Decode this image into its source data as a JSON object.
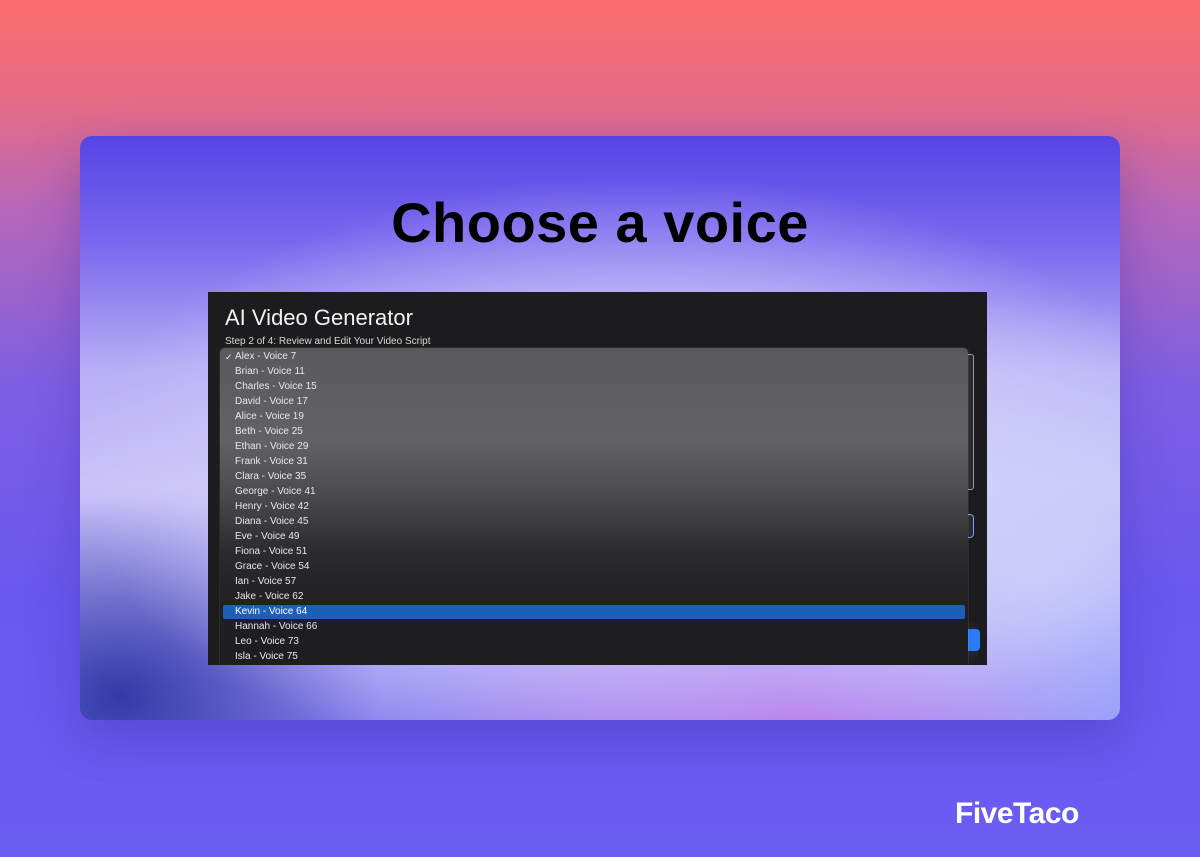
{
  "slide": {
    "heading": "Choose a voice",
    "brand": "FiveTaco"
  },
  "app": {
    "title": "AI Video Generator",
    "step": "Step 2 of 4: Review and Edit Your Video Script"
  },
  "voice_dropdown": {
    "checked_index": 0,
    "highlighted_index": 17,
    "options": [
      "Alex - Voice 7",
      "Brian - Voice 11",
      "Charles - Voice 15",
      "David - Voice 17",
      "Alice - Voice 19",
      "Beth - Voice 25",
      "Ethan - Voice 29",
      "Frank - Voice 31",
      "Clara - Voice 35",
      "George - Voice 41",
      "Henry - Voice 42",
      "Diana - Voice 45",
      "Eve - Voice 49",
      "Fiona - Voice 51",
      "Grace - Voice 54",
      "Ian - Voice 57",
      "Jake - Voice 62",
      "Kevin - Voice 64",
      "Hannah - Voice 66",
      "Leo - Voice 73",
      "Isla - Voice 75"
    ]
  },
  "icons": {
    "checkmark": "checkmark-icon"
  },
  "colors": {
    "highlight": "#1b5fb8",
    "primary_button": "#2a7bf5"
  }
}
